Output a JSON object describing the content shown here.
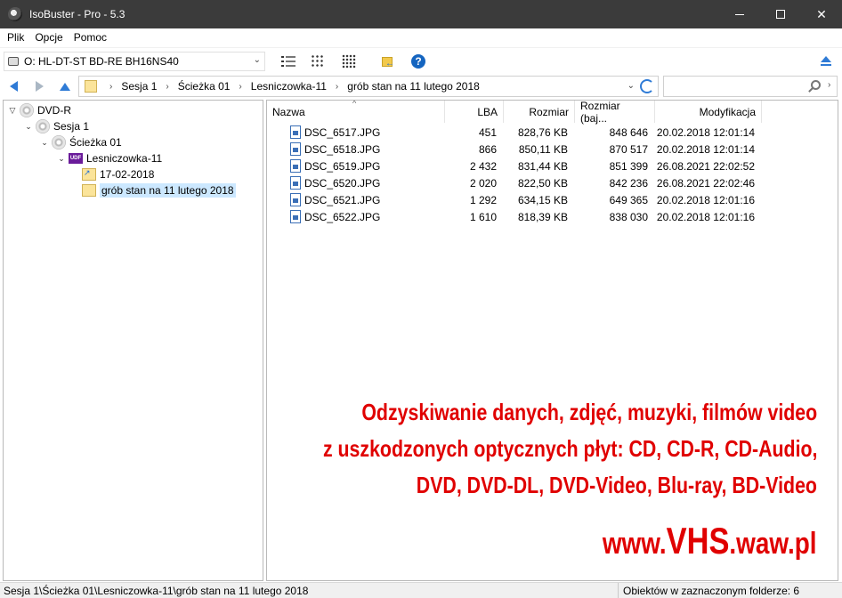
{
  "window": {
    "title": "IsoBuster - Pro - 5.3",
    "minimize_glyph": "—",
    "close_glyph": "✕"
  },
  "menu": [
    "Plik",
    "Opcje",
    "Pomoc"
  ],
  "toolbar": {
    "drive": "O: HL-DT-ST BD-RE  BH16NS40",
    "help_label": "?"
  },
  "nav": {
    "breadcrumb": [
      "Sesja 1",
      "Ścieżka 01",
      "Lesniczowka-11",
      "grób stan na 11 lutego 2018"
    ],
    "search_value": ""
  },
  "tree": {
    "items": [
      {
        "label": "DVD-R",
        "icon": "disc-icon",
        "expander": "▽"
      },
      {
        "label": "Sesja 1",
        "icon": "disc-icon",
        "expander": "⌄"
      },
      {
        "label": "Ścieżka 01",
        "icon": "disc-icon",
        "expander": "⌄"
      },
      {
        "label": "Lesniczowka-11",
        "icon": "udf-icon",
        "badge": "UDF",
        "expander": "⌄"
      },
      {
        "label": "17-02-2018",
        "icon": "folder-link-icon",
        "expander": ""
      },
      {
        "label": "grób stan na 11 lutego 2018",
        "icon": "folder-icon",
        "expander": "",
        "selected": true
      }
    ]
  },
  "list": {
    "columns": [
      "Nazwa",
      "LBA",
      "Rozmiar",
      "Rozmiar (baj...",
      "Modyfikacja"
    ],
    "sort_indicator": "^",
    "rows": [
      {
        "name": "DSC_6517.JPG",
        "lba": "451",
        "size": "828,76 KB",
        "bytes": "848 646",
        "modified": "20.02.2018 12:01:14"
      },
      {
        "name": "DSC_6518.JPG",
        "lba": "866",
        "size": "850,11 KB",
        "bytes": "870 517",
        "modified": "20.02.2018 12:01:14"
      },
      {
        "name": "DSC_6519.JPG",
        "lba": "2 432",
        "size": "831,44 KB",
        "bytes": "851 399",
        "modified": "26.08.2021 22:02:52"
      },
      {
        "name": "DSC_6520.JPG",
        "lba": "2 020",
        "size": "822,50 KB",
        "bytes": "842 236",
        "modified": "26.08.2021 22:02:46"
      },
      {
        "name": "DSC_6521.JPG",
        "lba": "1 292",
        "size": "634,15 KB",
        "bytes": "649 365",
        "modified": "20.02.2018 12:01:16"
      },
      {
        "name": "DSC_6522.JPG",
        "lba": "1 610",
        "size": "818,39 KB",
        "bytes": "838 030",
        "modified": "20.02.2018 12:01:16"
      }
    ]
  },
  "overlay": {
    "line1": "Odzyskiwanie danych, zdjęć, muzyki, filmów video",
    "line2": "z uszkodzonych optycznych płyt: CD, CD-R, CD-Audio,",
    "line3": "DVD, DVD-DL, DVD-Video, Blu-ray, BD-Video",
    "www_prefix": "www.",
    "www_brand": "VHS",
    "www_suffix": ".waw.pl",
    "color": "#e00000"
  },
  "status": {
    "path": "Sesja 1\\Ścieżka 01\\Lesniczowka-11\\grób stan na 11 lutego 2018",
    "count": "Obiektów w zaznaczonym folderze: 6"
  }
}
